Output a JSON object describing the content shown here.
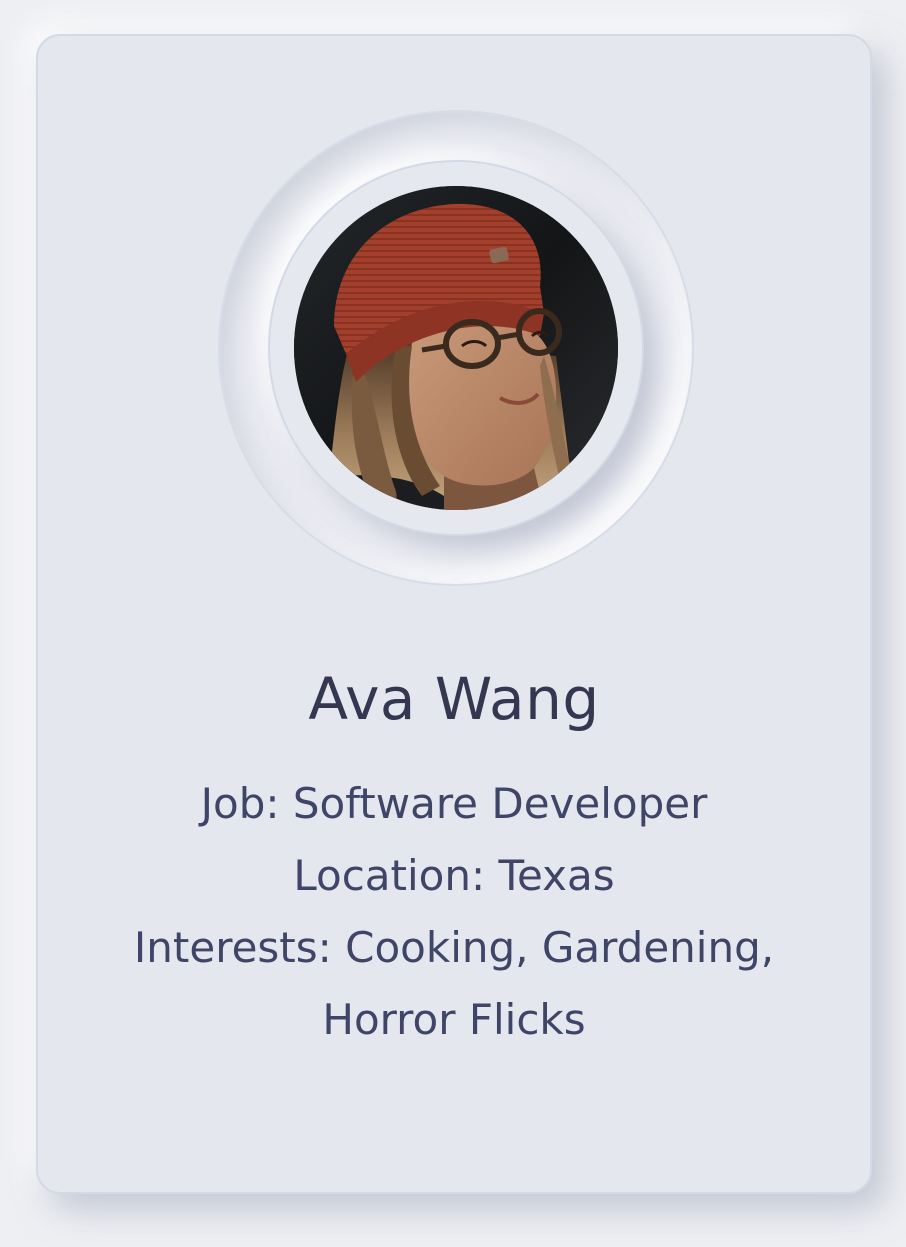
{
  "profile": {
    "name": "Ava Wang",
    "photo_alt": "Profile photo",
    "job_label": "Job:",
    "job": "Software Developer",
    "location_label": "Location:",
    "location": "Texas",
    "interests_label": "Interests:",
    "interests_line1": "Cooking, Gardening,",
    "interests_line2": "Horror Flicks"
  },
  "colors": {
    "page_background": "#eeeff3",
    "card_background": "#e5e7ef",
    "card_border": "#d3d9e5",
    "name_text": "#33374f",
    "detail_text": "#3f4566",
    "beanie": "#a3402d"
  }
}
